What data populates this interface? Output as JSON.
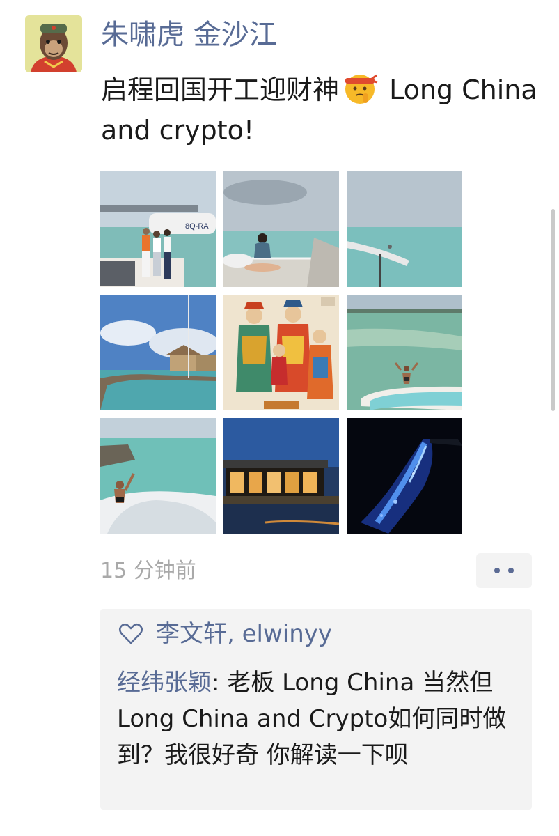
{
  "post": {
    "author": "朱啸虎 金沙江",
    "text_part1": "启程回国开工迎财神",
    "text_part2": " Long China and crypto!",
    "emoji_icon": "shushing-face-headband-emoji",
    "photos": [
      {
        "name": "seaplane-photo",
        "icon": "photo-thumbnail"
      },
      {
        "name": "woman-on-net-photo",
        "icon": "photo-thumbnail"
      },
      {
        "name": "overwater-swing-photo",
        "icon": "photo-thumbnail"
      },
      {
        "name": "overwater-villa-photo",
        "icon": "photo-thumbnail"
      },
      {
        "name": "god-of-wealth-painting",
        "icon": "photo-thumbnail"
      },
      {
        "name": "lagoon-jump-photo",
        "icon": "photo-thumbnail"
      },
      {
        "name": "water-slide-photo",
        "icon": "photo-thumbnail"
      },
      {
        "name": "restaurant-dusk-photo",
        "icon": "photo-thumbnail"
      },
      {
        "name": "bioluminescent-beach-photo",
        "icon": "photo-thumbnail"
      }
    ],
    "timestamp": "15 分钟前",
    "more_icon": "more-dots-icon"
  },
  "interactions": {
    "like_icon": "heart-outline-icon",
    "likers": "李文轩, elwinyy",
    "comments": [
      {
        "author": "经纬张颖",
        "separator": ": ",
        "text": "老板 Long China 当然但Long China and Crypto如何同时做到？我很好奇 你解读一下呗"
      }
    ]
  },
  "colors": {
    "link": "#586b95",
    "text": "#1a1a1a",
    "muted": "#a9a9a9",
    "panel": "#f3f3f3"
  }
}
